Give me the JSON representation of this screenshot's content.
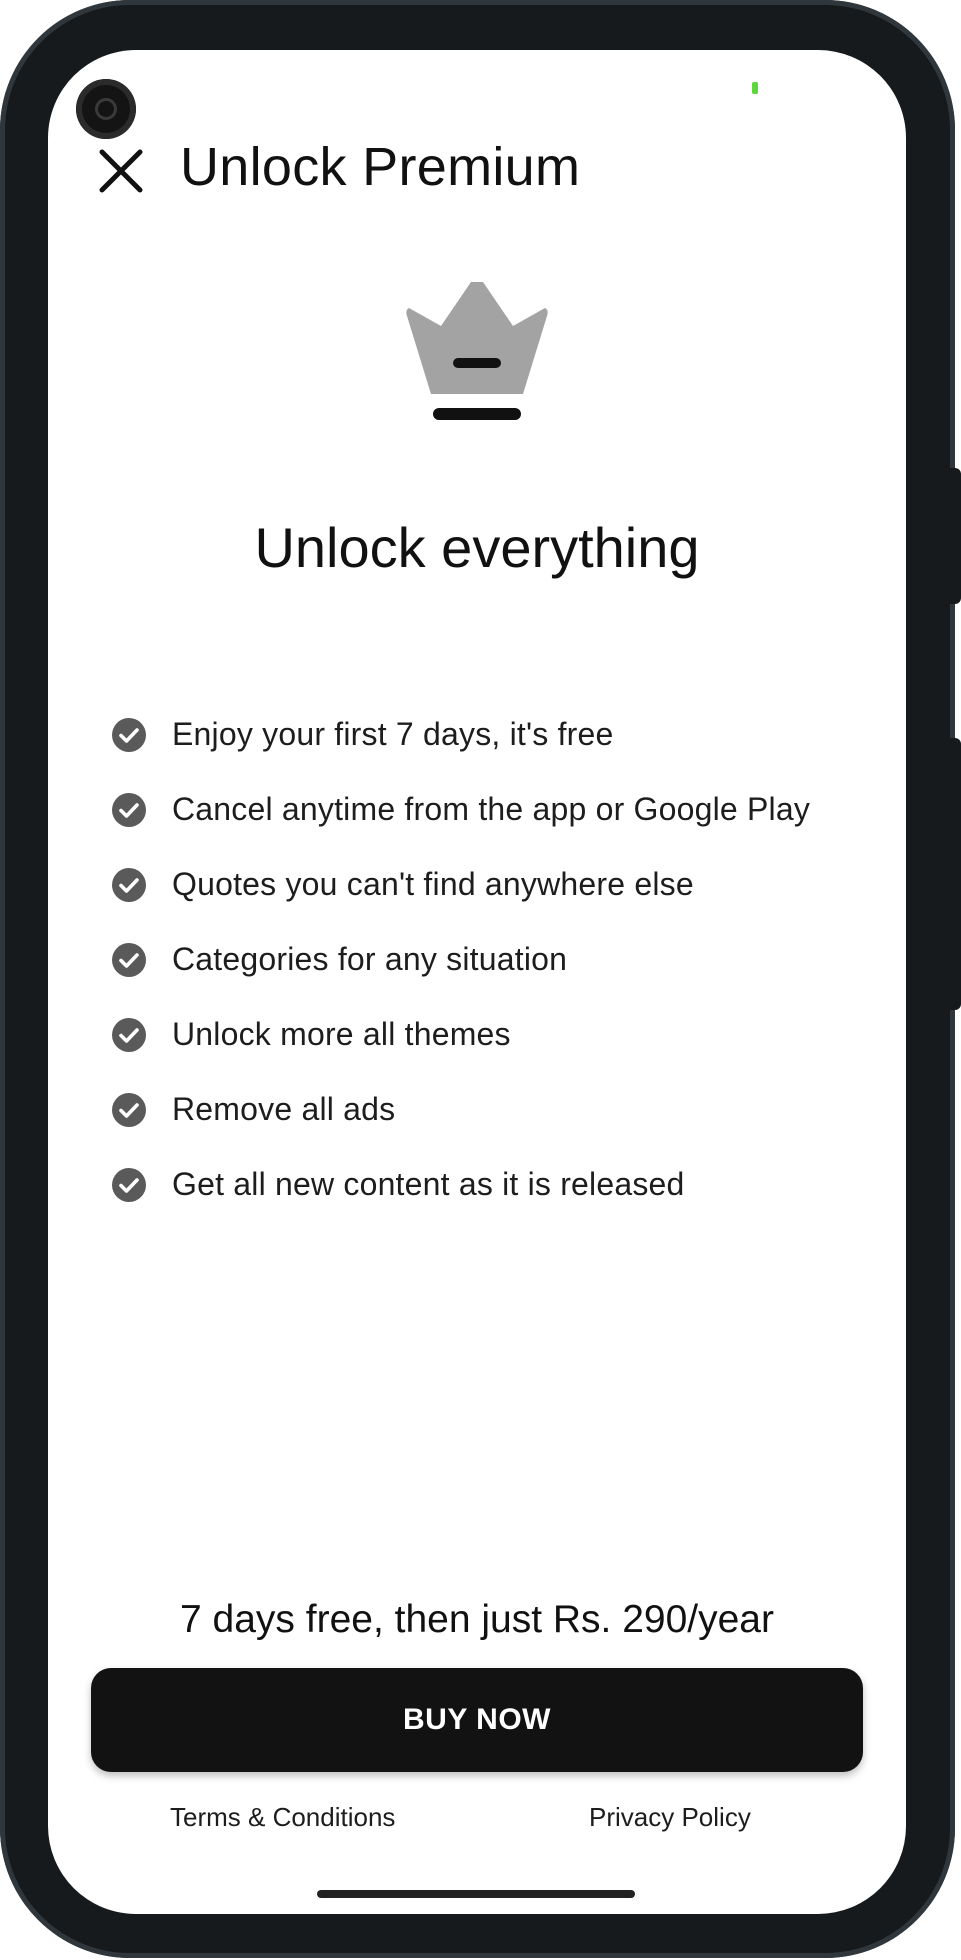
{
  "header": {
    "title": "Unlock Premium",
    "close_icon": "close-icon"
  },
  "hero": {
    "icon": "crown-icon",
    "headline": "Unlock everything"
  },
  "features": [
    "Enjoy your first 7 days, it's free",
    "Cancel anytime from the app or Google Play",
    "Quotes you can't find anywhere else",
    "Categories for any situation",
    "Unlock more all themes",
    "Remove all ads",
    "Get all new content as it is released"
  ],
  "pricing": {
    "text": "7 days free, then just Rs. 290/year",
    "button_label": "BUY NOW"
  },
  "footer": {
    "terms_label": "Terms & Conditions",
    "privacy_label": "Privacy Policy"
  },
  "colors": {
    "button_background": "#121212",
    "check_icon": "#5a5a5a",
    "crown": "#a3a3a3",
    "device_frame": "#161a1c"
  }
}
